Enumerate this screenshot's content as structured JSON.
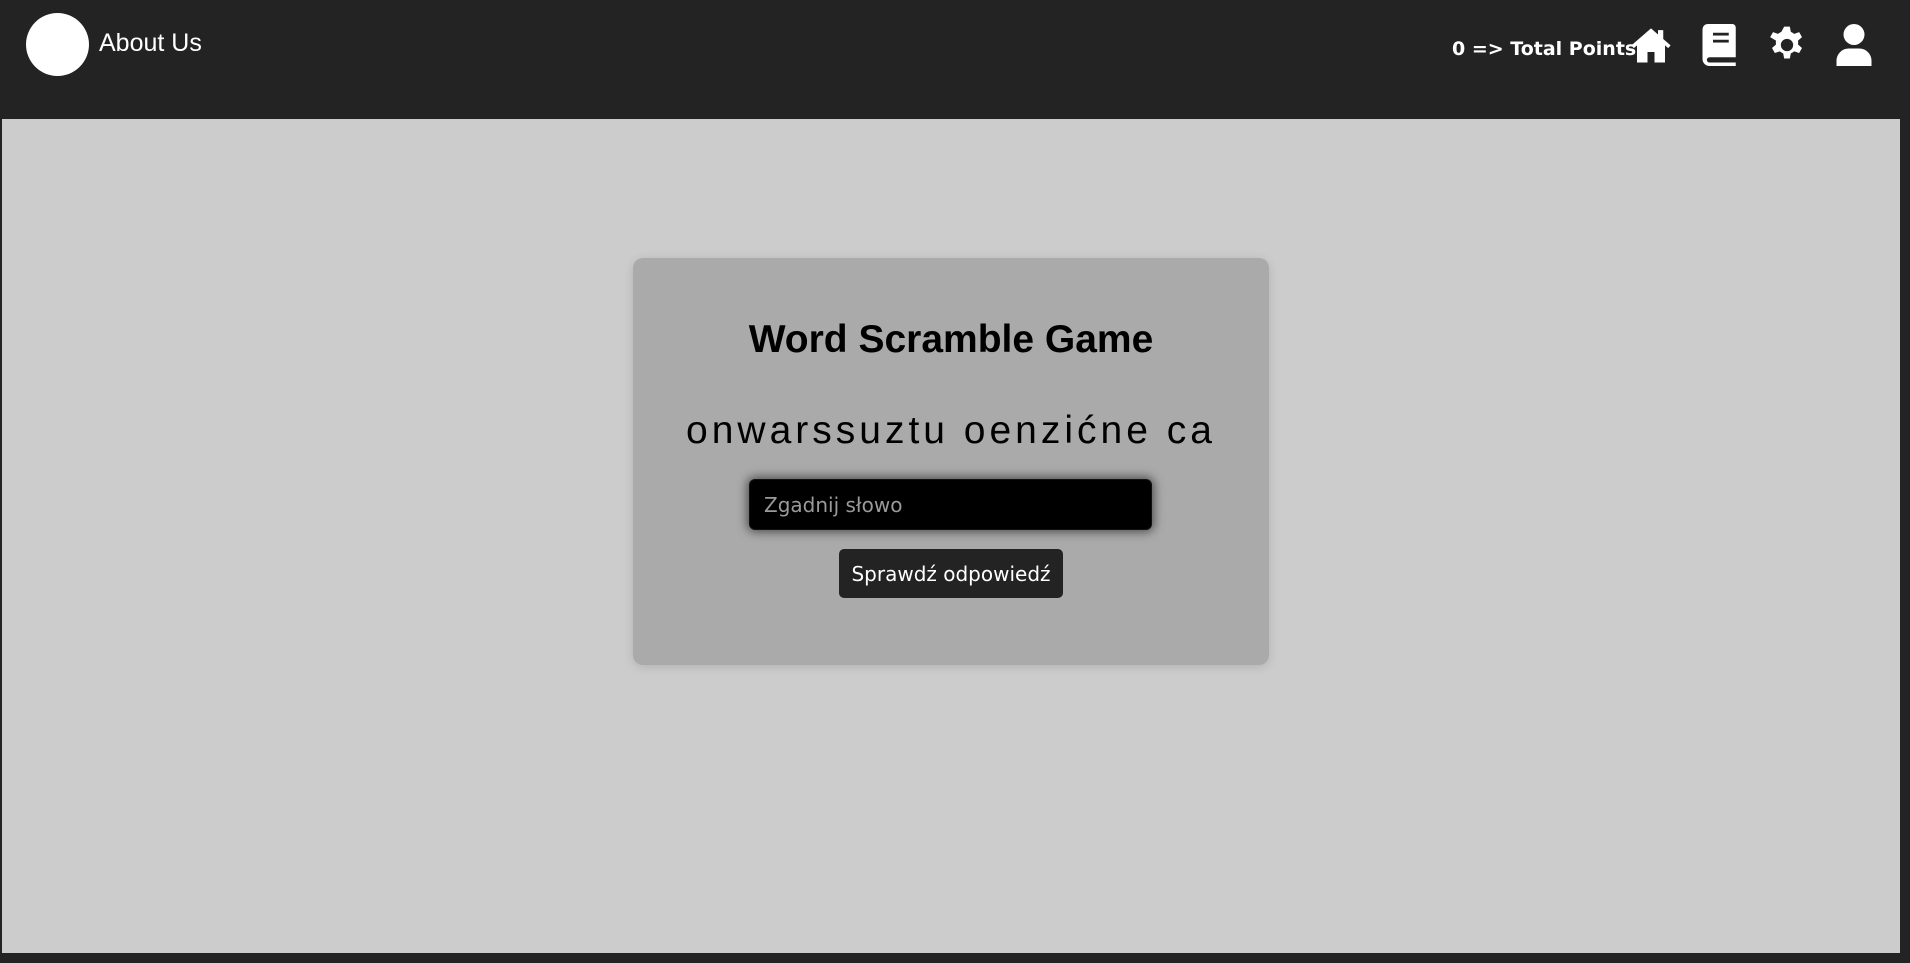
{
  "navbar": {
    "about_label": "About Us",
    "points_text": "0 => Total Points",
    "icons": {
      "home": "home-icon",
      "book": "book-icon",
      "settings": "gear-icon",
      "user": "user-icon"
    }
  },
  "game": {
    "title": "Word Scramble Game",
    "scrambled_word": "onwarssuztu oenzićne ca",
    "input_placeholder": "Zgadnij słowo",
    "input_value": "",
    "check_button_label": "Sprawdź odpowiedź"
  },
  "colors": {
    "navbar_bg": "#232323",
    "page_bg": "#cccccc",
    "card_bg": "#aaaaaa",
    "input_bg": "#000000",
    "button_bg": "#232323"
  }
}
